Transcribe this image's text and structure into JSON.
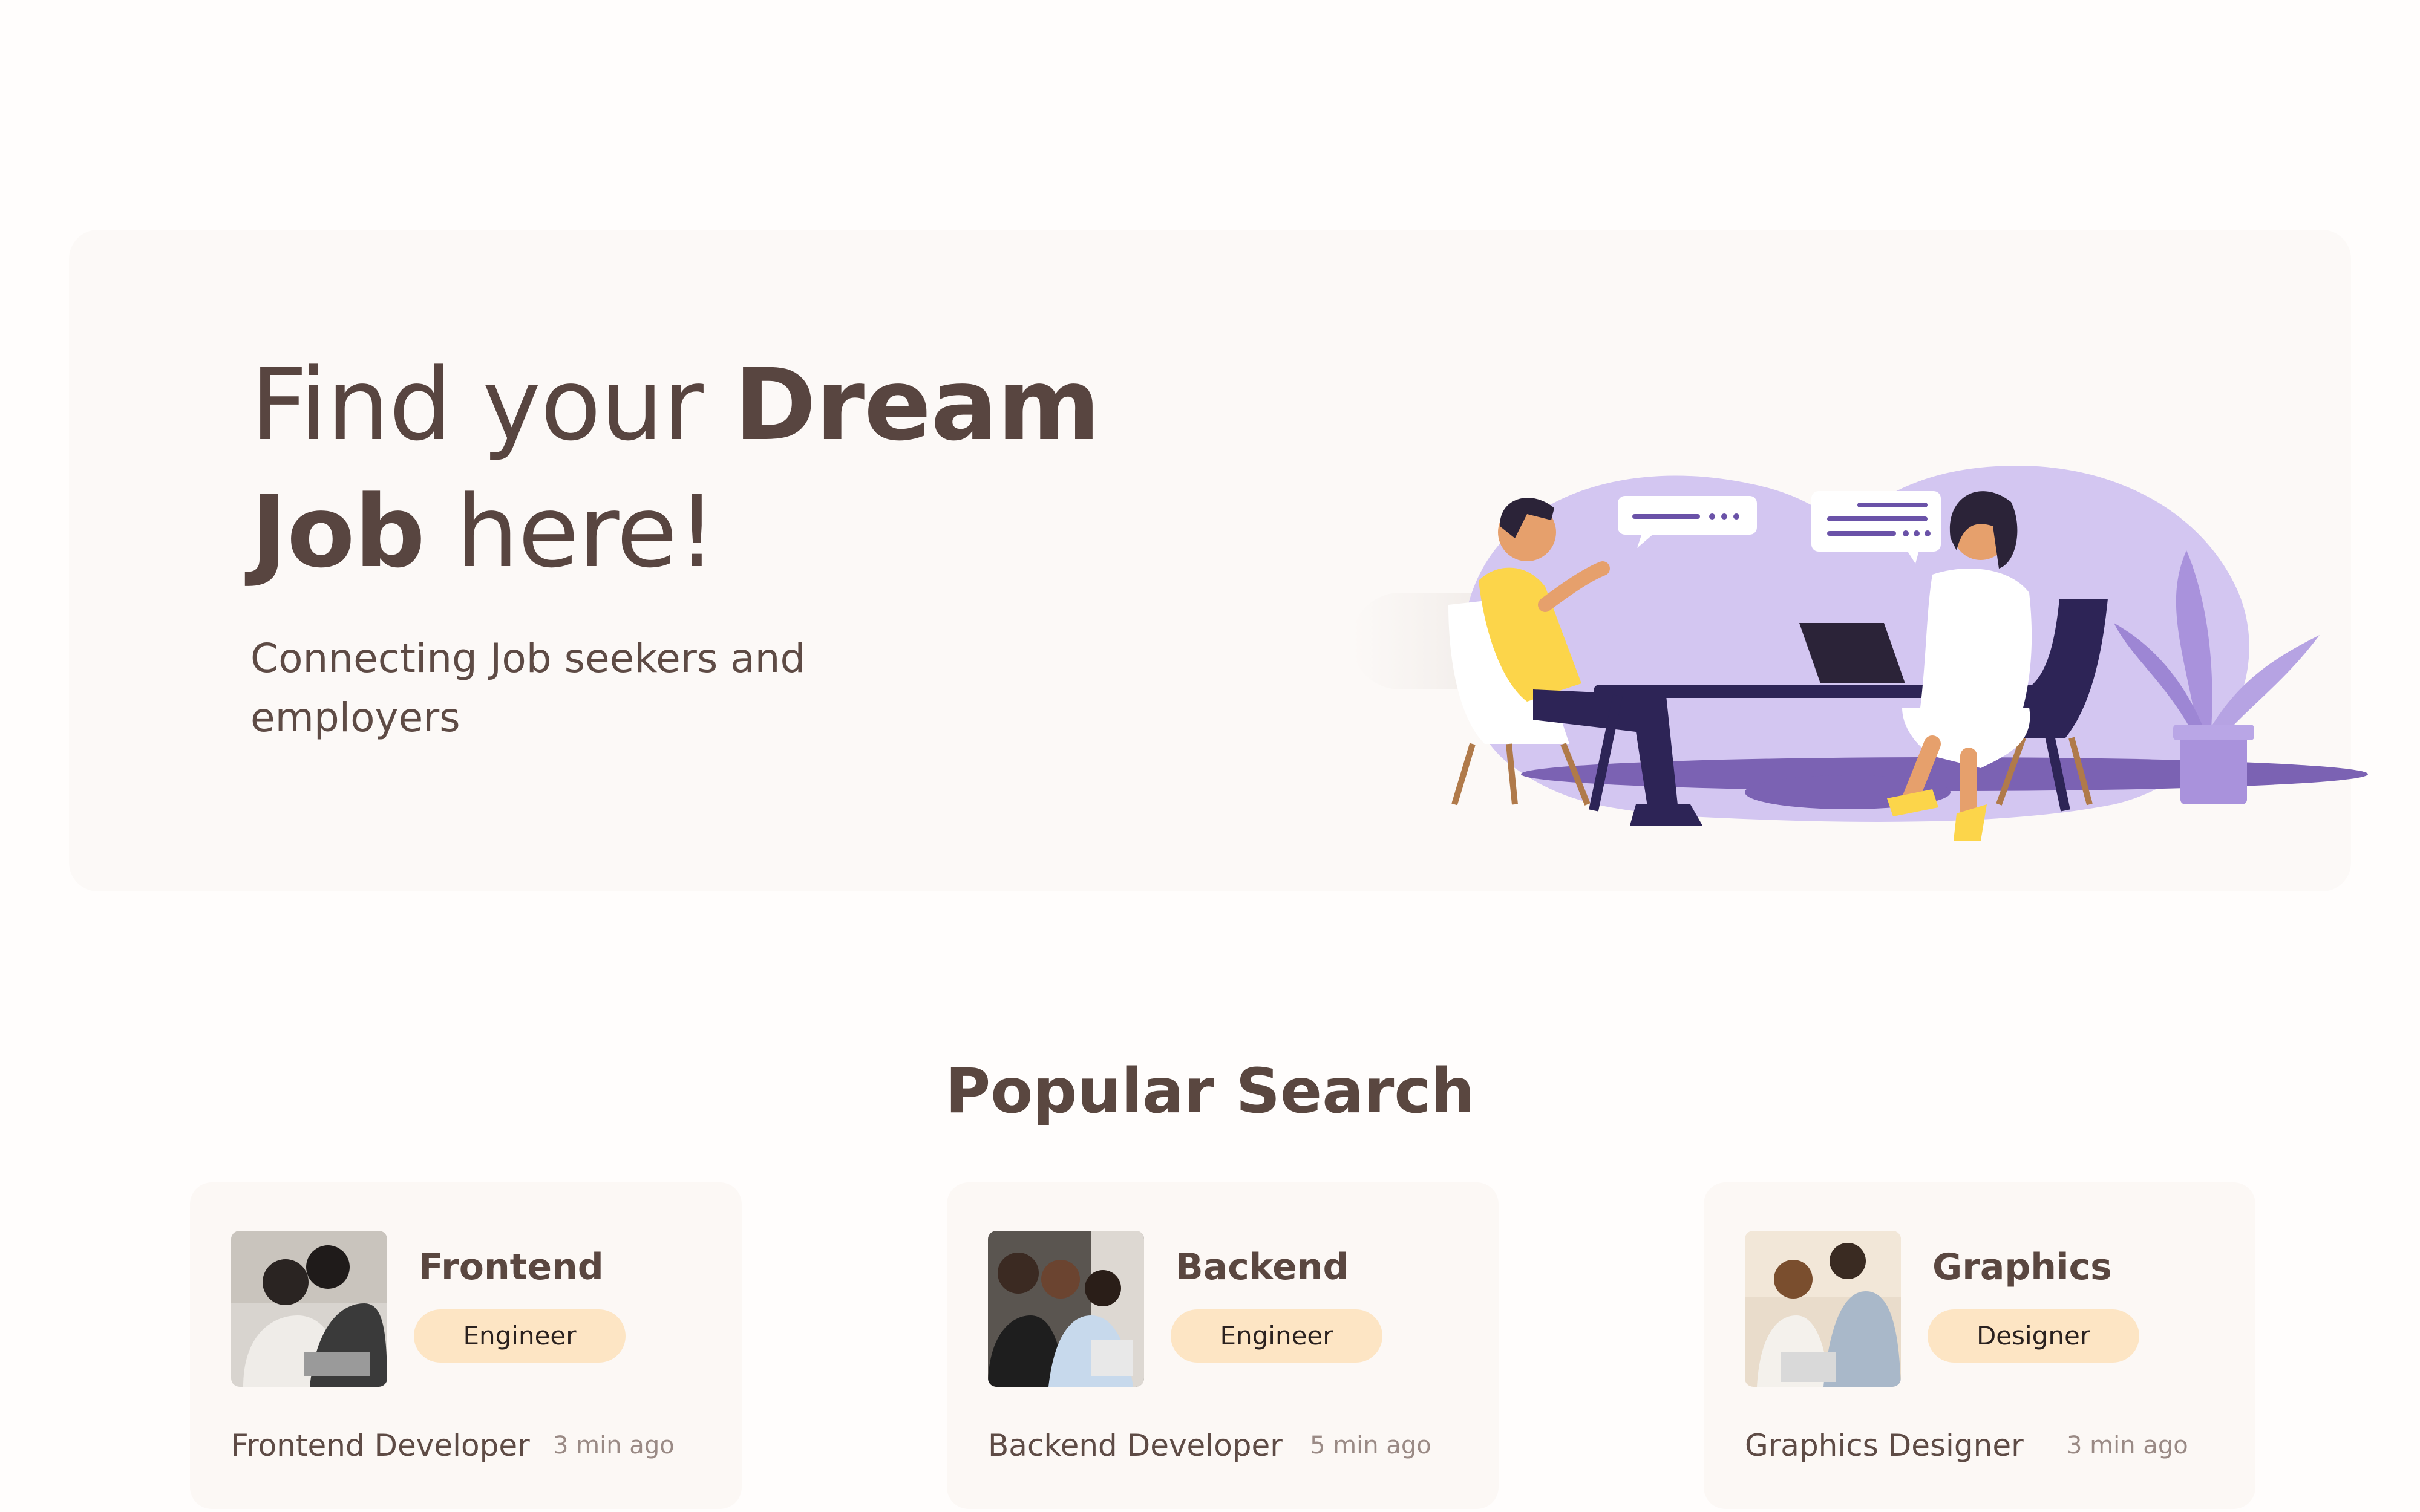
{
  "hero": {
    "title_part1": "Find your ",
    "title_bold1": "Dream",
    "title_bold2": "Job",
    "title_part2": " here!",
    "subtitle": "Connecting Job seekers and employers"
  },
  "popular": {
    "heading": "Popular Search",
    "cards": [
      {
        "role": "Frontend",
        "badge": "Engineer",
        "job_title": "Frontend Developer",
        "time": "3 min ago"
      },
      {
        "role": "Backend",
        "badge": "Engineer",
        "job_title": "Backend Developer",
        "time": "5 min ago"
      },
      {
        "role": "Graphics",
        "badge": "Designer",
        "job_title": "Graphics Designer",
        "time": "3 min ago"
      }
    ]
  },
  "colors": {
    "accent_purple": "#d3c6f1",
    "badge_bg": "#fde5c4",
    "text": "#5a4740"
  },
  "icons": {
    "illustration": "job-interview-illustration"
  }
}
